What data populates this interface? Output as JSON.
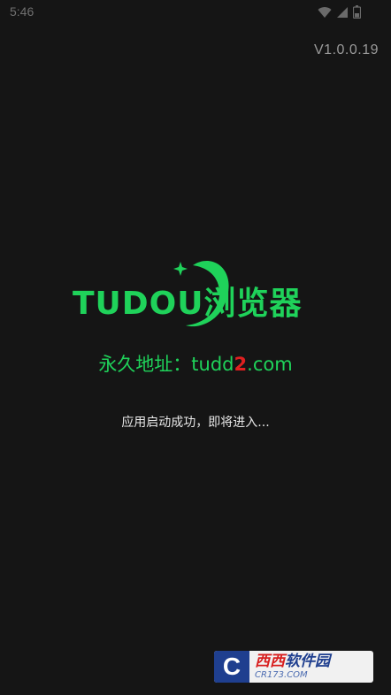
{
  "status_bar": {
    "time": "5:46",
    "icons": [
      "wifi-icon",
      "signal-icon",
      "battery-icon"
    ]
  },
  "version": "V1.0.0.19",
  "logo": {
    "text": "TUDOU浏览器",
    "color": "#1fd25a"
  },
  "address": {
    "prefix": "永久地址：tudd",
    "number": "2",
    "suffix": ".com"
  },
  "loading_text": "应用启动成功，即将进入...",
  "watermark": {
    "title_a": "西西",
    "title_b": "软件园",
    "sub": "CR173.COM",
    "letter": "C"
  },
  "colors": {
    "background": "#151515",
    "brand_green": "#1fd25a",
    "accent_red": "#e02020"
  }
}
